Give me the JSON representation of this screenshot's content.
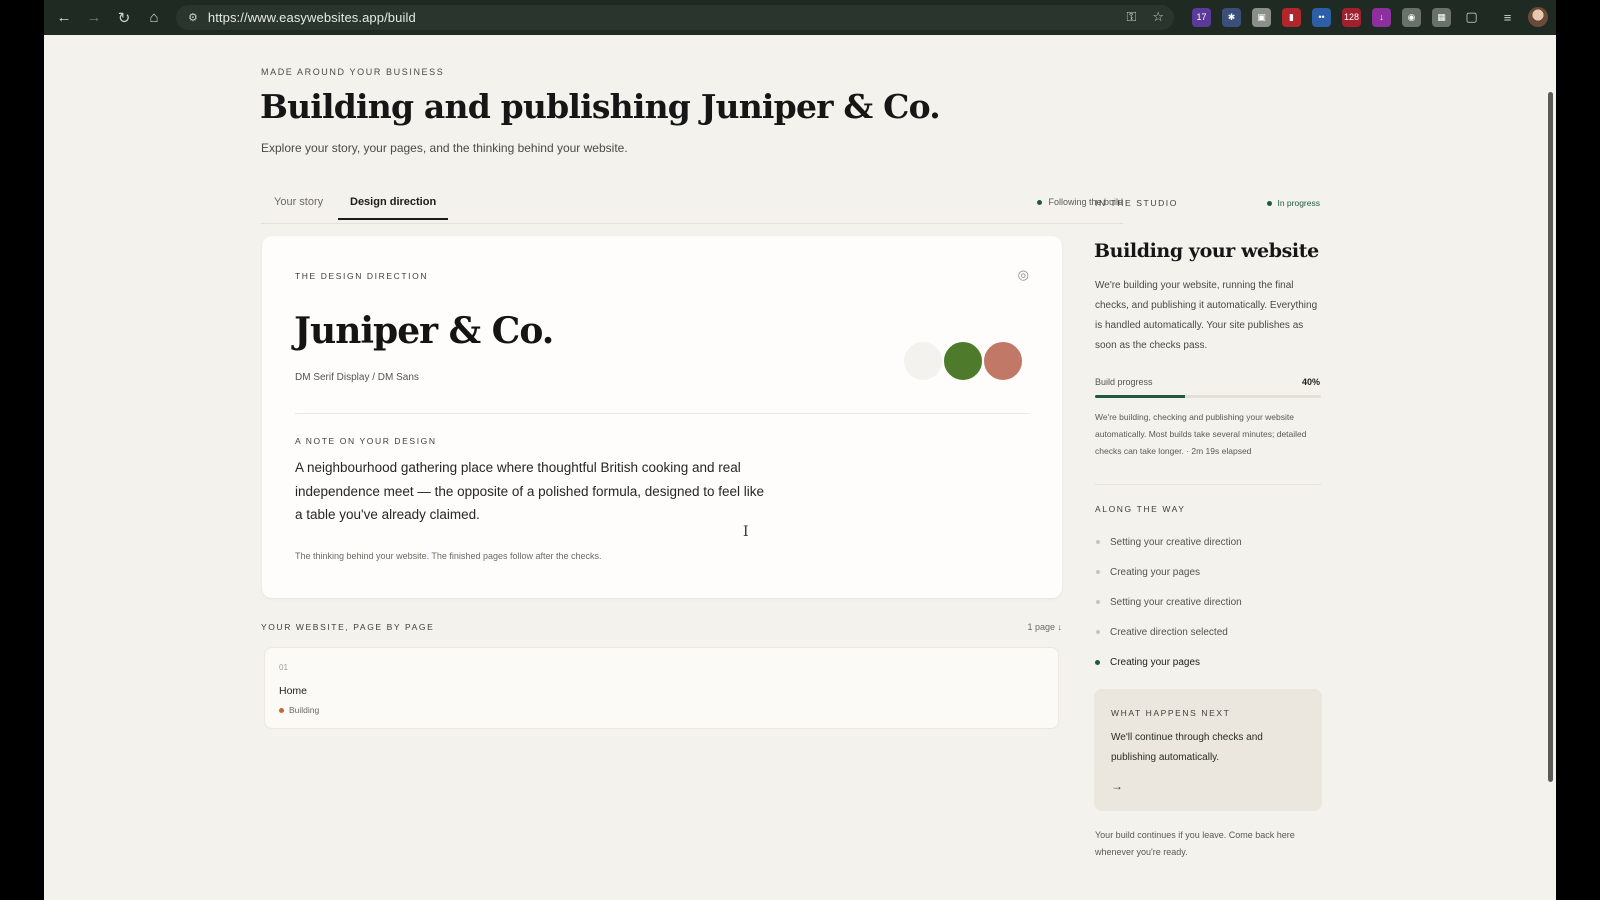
{
  "browser": {
    "url": "https://www.easywebsites.app/build",
    "back_icon": "arrow-left-icon",
    "forward_icon": "arrow-right-icon",
    "reload_icon": "reload-icon",
    "home_icon": "home-icon",
    "ext_badge_1": "17",
    "ext_badge_2": "128"
  },
  "header": {
    "eyebrow": "MADE AROUND YOUR BUSINESS",
    "title": "Building and publishing Juniper & Co.",
    "subtitle": "Explore your story, your pages, and the thinking behind your website."
  },
  "tabs": {
    "items": [
      {
        "label": "Your story"
      },
      {
        "label": "Design direction"
      }
    ],
    "active": "Design direction",
    "following_label": "Following the build"
  },
  "design": {
    "eyebrow": "THE DESIGN DIRECTION",
    "brand_name": "Juniper & Co.",
    "fonts": "DM Serif Display / DM Sans",
    "swatches": [
      "#f3f2ee",
      "#4e7a2c",
      "#c27866"
    ],
    "note_eyebrow": "A NOTE ON YOUR DESIGN",
    "note": "A neighbourhood gathering place where thoughtful British cooking and real independence meet — the opposite of a polished formula, designed to feel like a table you've already claimed.",
    "footnote": "The thinking behind your website. The finished pages follow after the checks."
  },
  "pages": {
    "eyebrow": "YOUR WEBSITE, PAGE BY PAGE",
    "count_label": "1 page",
    "items": [
      {
        "number": "01",
        "name": "Home",
        "status": "Building"
      }
    ]
  },
  "studio": {
    "eyebrow": "IN THE STUDIO",
    "status": "In progress",
    "title": "Building your website",
    "body": "We're building your website, running the final checks, and publishing it automatically. Everything is handled automatically. Your site publishes as soon as the checks pass.",
    "progress_label": "Build progress",
    "progress_text": "40%",
    "progress_value": 0.4,
    "progress_note": "We're building, checking and publishing your website automatically. Most builds take several minutes; detailed checks can take longer. · 2m 19s elapsed",
    "along_eyebrow": "ALONG THE WAY",
    "steps": [
      {
        "label": "Setting your creative direction"
      },
      {
        "label": "Creating your pages"
      },
      {
        "label": "Setting your creative direction"
      },
      {
        "label": "Creative direction selected"
      },
      {
        "label": "Creating your pages"
      }
    ],
    "active_step": "Creating your pages",
    "next_eyebrow": "WHAT HAPPENS NEXT",
    "next_body": "We'll continue through checks and publishing automatically.",
    "leave_note": "Your build continues if you leave. Come back here whenever you're ready."
  },
  "colors": {
    "accent": "#1f5a44",
    "building": "#c46a2a",
    "background": "#f4f2ec"
  }
}
